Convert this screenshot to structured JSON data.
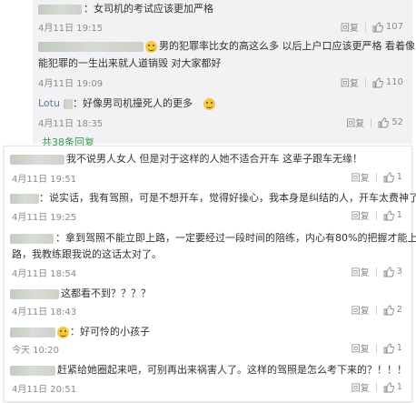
{
  "top": {
    "comments": [
      {
        "text": "：女司机的考试应该更加严格",
        "time": "4月11日 19:15",
        "reply": "回复",
        "likes": "107"
      },
      {
        "text_line1": "男的犯罪率比女的高这么多 以后上户口应该更严格 看着像以后",
        "text_line2": "能犯罪的一生出来就人道销毁 对大家都好",
        "time": "4月11日 19:09",
        "reply": "回复",
        "likes": "110"
      },
      {
        "user": "Lotu",
        "text": "：好像男司机撞死人的更多",
        "time": "4月11日 18:35",
        "reply": "回复",
        "likes": "52"
      }
    ],
    "more_replies": "共38条回复"
  },
  "bottom": {
    "comments": [
      {
        "text": "我不说男人女人 但是对于这样的人她不适合开车 这辈子跟车无缘！",
        "time": "4月11日 19:51",
        "reply": "回复",
        "likes": "1"
      },
      {
        "text": "：说实话，我有驾照，可是不想开车，觉得好操心，我本身是纠结的人，开车太费神了",
        "time": "4月11日 19:25",
        "reply": "回复",
        "likes": "1"
      },
      {
        "text_line1": "：拿到驾照不能立即上路，一定要经过一段时间的陪练，内心有80%的把握才能上",
        "text_line2": "路，我教练跟我说的这话太对了。",
        "time": "4月11日 18:54",
        "reply": "回复",
        "likes": "3"
      },
      {
        "text": "这都看不到？？？？",
        "time": "4月11日 18:43",
        "reply": "回复",
        "likes": "2"
      },
      {
        "text": "：好可怜的小孩子",
        "time": "今天 10:20",
        "reply": "回复",
        "likes": "1"
      },
      {
        "text": "赶紧给她圈起来吧，可别再出来祸害人了。这样的驾照是怎么考下来的？！！！",
        "time": "4月11日 20:51",
        "reply": "回复",
        "likes": "1"
      }
    ]
  },
  "colors": {
    "link": "#5a7a9c",
    "more": "#3b9a5a",
    "meta": "#8a8a8a"
  }
}
